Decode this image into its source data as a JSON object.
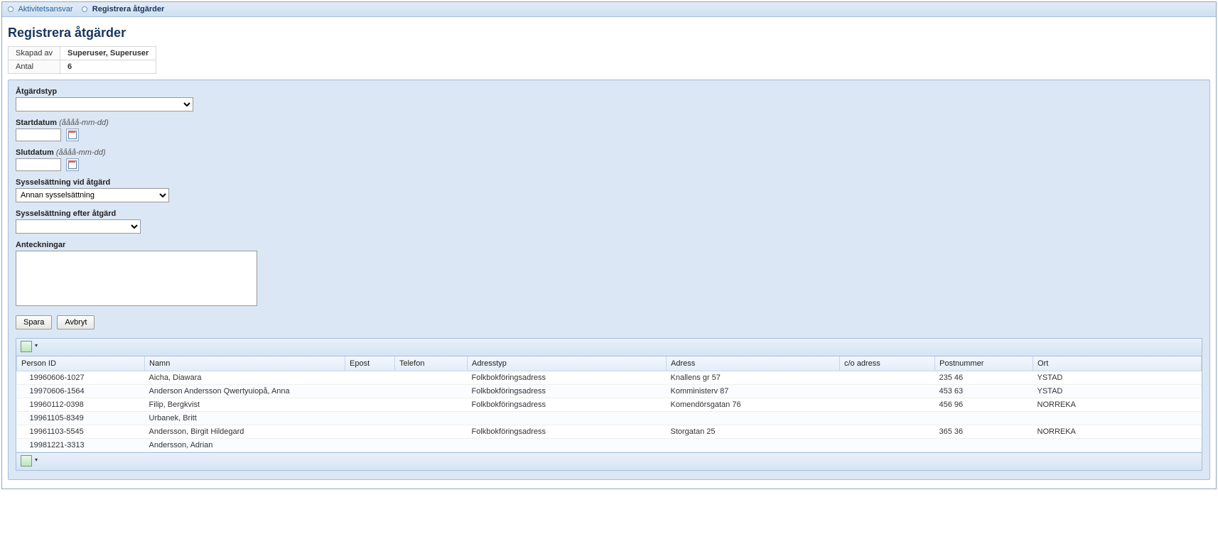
{
  "breadcrumb": {
    "parent": "Aktivitetsansvar",
    "current": "Registrera åtgärder"
  },
  "page_title": "Registrera åtgärder",
  "meta": {
    "created_by_label": "Skapad av",
    "created_by_value": "Superuser, Superuser",
    "count_label": "Antal",
    "count_value": "6"
  },
  "form": {
    "action_type_label": "Åtgärdstyp",
    "action_type_value": "",
    "start_date_label": "Startdatum",
    "date_hint": "(åååå-mm-dd)",
    "start_date_value": "",
    "end_date_label": "Slutdatum",
    "end_date_value": "",
    "occupation_during_label": "Sysselsättning vid åtgärd",
    "occupation_during_value": "Annan sysselsättning",
    "occupation_after_label": "Sysselsättning efter åtgärd",
    "occupation_after_value": "",
    "notes_label": "Anteckningar",
    "notes_value": "",
    "save_label": "Spara",
    "cancel_label": "Avbryt"
  },
  "grid": {
    "columns": {
      "person_id": "Person ID",
      "name": "Namn",
      "email": "Epost",
      "phone": "Telefon",
      "address_type": "Adresstyp",
      "address": "Adress",
      "co_address": "c/o adress",
      "zip": "Postnummer",
      "city": "Ort"
    },
    "rows": [
      {
        "person_id": "19960606-1027",
        "name": "Aicha, Diawara",
        "email": "",
        "phone": "",
        "address_type": "Folkbokföringsadress",
        "address": "Knallens gr 57",
        "co_address": "",
        "zip": "235 46",
        "city": "YSTAD"
      },
      {
        "person_id": "19970606-1564",
        "name": "Anderson Andersson Qwertyuiopå, Anna",
        "email": "",
        "phone": "",
        "address_type": "Folkbokföringsadress",
        "address": "Komministerv 87",
        "co_address": "",
        "zip": "453 63",
        "city": "YSTAD"
      },
      {
        "person_id": "19960112-0398",
        "name": "Filip, Bergkvist",
        "email": "",
        "phone": "",
        "address_type": "Folkbokföringsadress",
        "address": "Komendörsgatan 76",
        "co_address": "",
        "zip": "456 96",
        "city": "NORREKA"
      },
      {
        "person_id": "19961105-8349",
        "name": "Urbanek, Britt",
        "email": "",
        "phone": "",
        "address_type": "",
        "address": "",
        "co_address": "",
        "zip": "",
        "city": ""
      },
      {
        "person_id": "19961103-5545",
        "name": "Andersson, Birgit Hildegard",
        "email": "",
        "phone": "",
        "address_type": "Folkbokföringsadress",
        "address": "Storgatan 25",
        "co_address": "",
        "zip": "365 36",
        "city": "NORREKA"
      },
      {
        "person_id": "19981221-3313",
        "name": "Andersson, Adrian",
        "email": "",
        "phone": "",
        "address_type": "",
        "address": "",
        "co_address": "",
        "zip": "",
        "city": ""
      }
    ]
  }
}
